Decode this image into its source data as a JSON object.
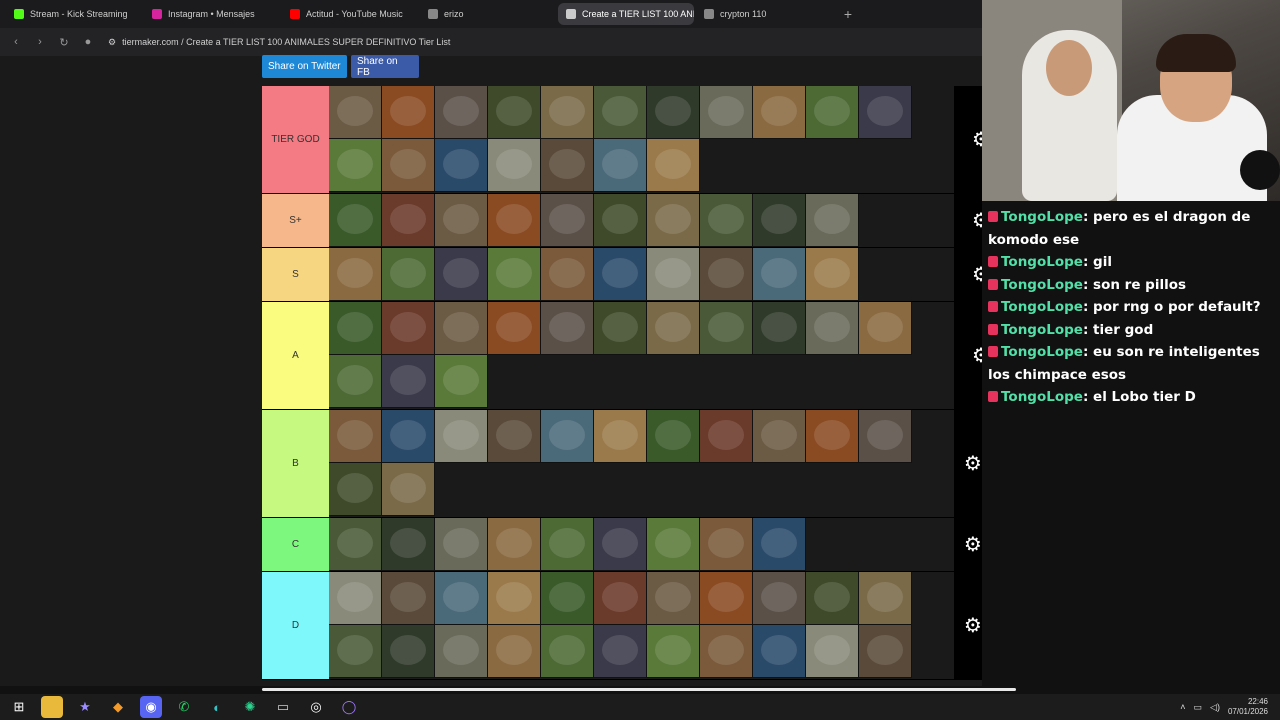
{
  "browser": {
    "tabs": [
      {
        "label": "Stream - Kick Streaming",
        "color": "#53fc18",
        "active": false
      },
      {
        "label": "Instagram • Mensajes",
        "color": "#d6249f",
        "active": false
      },
      {
        "label": "Actitud - YouTube Music",
        "color": "#ff0000",
        "active": false
      },
      {
        "label": "erizo",
        "color": "#888888",
        "active": false
      },
      {
        "label": "Create a TIER LIST 100 ANIMA",
        "color": "#cccccc",
        "active": true
      },
      {
        "label": "crypton 110",
        "color": "#888888",
        "active": false
      }
    ],
    "new_tab": "+",
    "url": "tiermaker.com / Create a TIER LIST 100 ANIMALES SUPER DEFINITIVO Tier List"
  },
  "share": {
    "twitter": "Share on Twitter",
    "fb": "Share on FB"
  },
  "tiers": [
    {
      "label": "TIER GOD",
      "color": "#f47a83",
      "count": 18,
      "arrows": false
    },
    {
      "label": "S+",
      "color": "#f6b78a",
      "count": 10,
      "arrows": false
    },
    {
      "label": "S",
      "color": "#f7d682",
      "count": 10,
      "arrows": false
    },
    {
      "label": "A",
      "color": "#fafc7f",
      "count": 14,
      "arrows": false
    },
    {
      "label": "B",
      "color": "#c5f97f",
      "count": 13,
      "arrows": true
    },
    {
      "label": "C",
      "color": "#7ef77e",
      "count": 9,
      "arrows": true
    },
    {
      "label": "D",
      "color": "#7ff8fb",
      "count": 22,
      "arrows": true
    }
  ],
  "chat": [
    {
      "user": "TongoLope",
      "text": "pero es el dragon de komodo ese"
    },
    {
      "user": "TongoLope",
      "text": "gil"
    },
    {
      "user": "TongoLope",
      "text": "son re pillos"
    },
    {
      "user": "TongoLope",
      "text": "por rng o por default?"
    },
    {
      "user": "TongoLope",
      "text": "tier god"
    },
    {
      "user": "TongoLope",
      "text": "eu son re inteligentes los chimpace esos"
    },
    {
      "user": "TongoLope",
      "text": "el Lobo tier D"
    }
  ],
  "taskbar": {
    "time": "22:46",
    "date": "07/01/2026"
  },
  "colors": {
    "chat_user": "#52e0a8",
    "badge": "#e6335d"
  }
}
